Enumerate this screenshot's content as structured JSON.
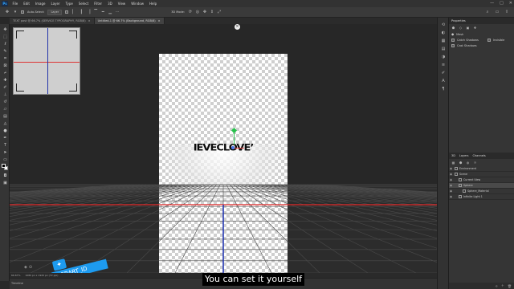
{
  "app": {
    "logo": "Ps"
  },
  "menu": [
    "File",
    "Edit",
    "Image",
    "Layer",
    "Type",
    "Select",
    "Filter",
    "3D",
    "View",
    "Window",
    "Help"
  ],
  "window_controls": [
    "—",
    "□",
    "✕"
  ],
  "options_bar": {
    "auto_select_label": "Auto-Select:",
    "auto_select_target": "Layer",
    "mode_3d_label": "3D Mode:"
  },
  "tabs": [
    {
      "label": "TEXT post @ 66.7% (SERVICE TYPOGRAPHY, RGB/8)",
      "close": "×"
    },
    {
      "label": "Untitled-1 @ 66.7% (Background, RGB/8)",
      "close": "×"
    }
  ],
  "canvas": {
    "word_art": "IEVECLOVE’",
    "close_symbol": "×"
  },
  "status": {
    "zoom": "66.67%",
    "doc_size": "1080 px x 1920 px (72 ppi)"
  },
  "timeline": {
    "label": "Timeline"
  },
  "properties_panel": {
    "title": "Properties",
    "mesh_label": "Mesh",
    "catch_shadows": "Catch Shadows",
    "cast_shadows": "Cast Shadows",
    "invisible": "Invisible"
  },
  "layers_panel": {
    "tabs": [
      "3D",
      "Layers",
      "Channels"
    ],
    "rows": [
      {
        "label": "Environment",
        "indent": 0
      },
      {
        "label": "Scene",
        "indent": 0
      },
      {
        "label": "Current View",
        "indent": 1
      },
      {
        "label": "Sphere",
        "indent": 1
      },
      {
        "label": "Sphere_Material",
        "indent": 2
      },
      {
        "label": "Infinite Light 1",
        "indent": 1
      }
    ],
    "selected_index": 3
  },
  "watermark": {
    "handle": "@ERART_ID"
  },
  "subtitle": "You can set it yourself",
  "colors": {
    "accent_blue": "#1d9bf0",
    "axis_red": "#e02a2a",
    "axis_blue": "#1a2fb0",
    "gizmo_green": "#27c24c"
  }
}
